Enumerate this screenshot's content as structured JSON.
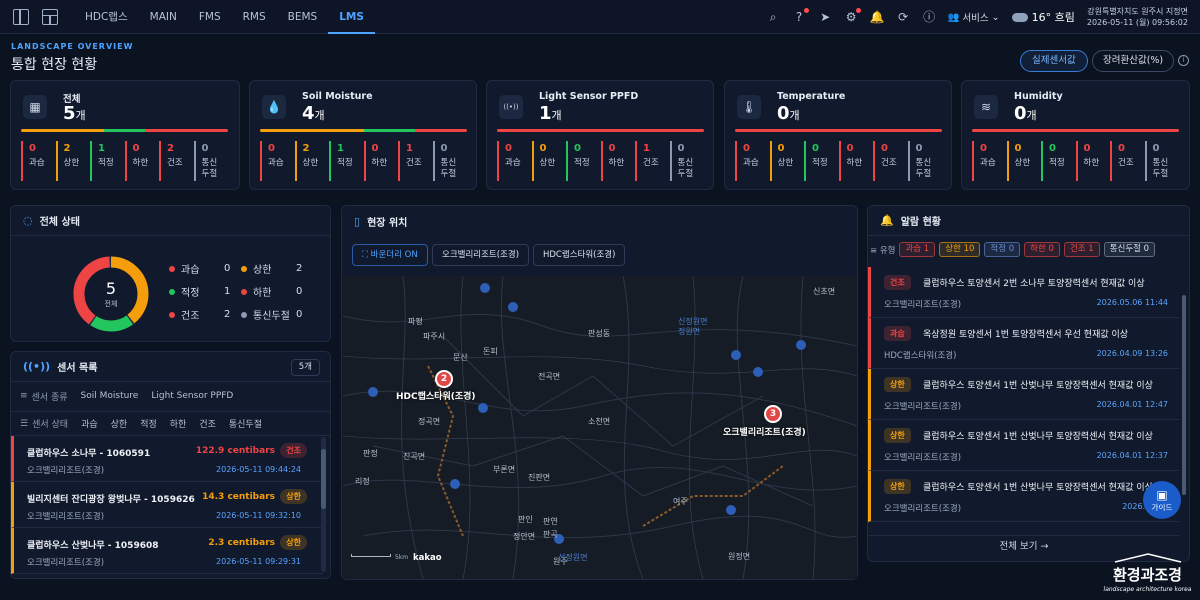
{
  "nav": {
    "items": [
      "HDC랩스",
      "MAIN",
      "FMS",
      "RMS",
      "BEMS",
      "LMS"
    ],
    "active": "LMS"
  },
  "header": {
    "service": "서비스",
    "temp": "16° 흐림",
    "location": "강원특별자치도 원주시 지정면",
    "datetime": "2026-05-11 (월) 09:56:02"
  },
  "page": {
    "overline": "LANDSCAPE OVERVIEW",
    "title": "통합 현장 현황",
    "btn_real": "실제센서값",
    "btn_conv": "장려환산값(%)"
  },
  "stat_labels": [
    "과습",
    "상한",
    "적정",
    "하한",
    "건조",
    "통신\n두절"
  ],
  "stat_colors": [
    "#ef4444",
    "#f59e0b",
    "#22c55e",
    "#ef4444",
    "#ef4444",
    "#8b9ab2"
  ],
  "cards": [
    {
      "name": "전체",
      "count": "5",
      "unit": "개",
      "values": [
        "0",
        "2",
        "1",
        "0",
        "2",
        "0"
      ],
      "icon": "grid-icon"
    },
    {
      "name": "Soil Moisture",
      "count": "4",
      "unit": "개",
      "values": [
        "0",
        "2",
        "1",
        "0",
        "1",
        "0"
      ],
      "icon": "drop-icon"
    },
    {
      "name": "Light Sensor PPFD",
      "count": "1",
      "unit": "개",
      "values": [
        "0",
        "0",
        "0",
        "0",
        "1",
        "0"
      ],
      "icon": "signal-icon"
    },
    {
      "name": "Temperature",
      "count": "0",
      "unit": "개",
      "values": [
        "0",
        "0",
        "0",
        "0",
        "0",
        "0"
      ],
      "icon": "thermometer-icon"
    },
    {
      "name": "Humidity",
      "count": "0",
      "unit": "개",
      "values": [
        "0",
        "0",
        "0",
        "0",
        "0",
        "0"
      ],
      "icon": "fan-icon"
    }
  ],
  "status": {
    "title": "전체 상태",
    "total": "5",
    "total_label": "전체",
    "legend": [
      {
        "label": "과습",
        "value": "0",
        "color": "#ef4444"
      },
      {
        "label": "상한",
        "value": "2",
        "color": "#f59e0b"
      },
      {
        "label": "적정",
        "value": "1",
        "color": "#22c55e"
      },
      {
        "label": "하한",
        "value": "0",
        "color": "#ef4444"
      },
      {
        "label": "건조",
        "value": "2",
        "color": "#ef4444"
      },
      {
        "label": "통신두절",
        "value": "0",
        "color": "#8b9ab2"
      }
    ]
  },
  "sensors": {
    "title": "센서 목록",
    "count": "5개",
    "type_label": "센서 종류",
    "types": [
      "Soil Moisture",
      "Light Sensor PPFD"
    ],
    "state_label": "센서 상태",
    "states": [
      "과습",
      "상한",
      "적정",
      "하한",
      "건조",
      "통신두절"
    ],
    "rows": [
      {
        "name": "클럽하우스 소나무 - 1060591",
        "site": "오크밸리리조트(조경)",
        "value": "122.9 centibars",
        "badge": "건조",
        "date": "2026-05-11 09:44:24",
        "color": "#ef4444"
      },
      {
        "name": "빌리지센터 잔디광장 왕벚나무 - 1059626",
        "site": "오크밸리리조트(조경)",
        "value": "14.3 centibars",
        "badge": "상한",
        "date": "2026-05-11 09:32:10",
        "color": "#f59e0b"
      },
      {
        "name": "클럽하우스 산벚나무 - 1059608",
        "site": "오크밸리리조트(조경)",
        "value": "2.3 centibars",
        "badge": "상한",
        "date": "2026-05-11 09:29:31",
        "color": "#f59e0b"
      }
    ]
  },
  "map": {
    "title": "현장 위치",
    "boundary": "바운더리 ON",
    "tabs": [
      "오크밸리리조트(조경)",
      "HDC랩스타워(조경)"
    ],
    "markers": [
      {
        "num": "2",
        "label": "HDC랩스타워(조경)"
      },
      {
        "num": "3",
        "label": "오크밸리리조트(조경)"
      }
    ],
    "places": [
      "신초면",
      "판성동",
      "신정원면",
      "정원면",
      "파평",
      "문산",
      "돈피",
      "파주시",
      "전곡면",
      "정곡면",
      "진곡면",
      "소천면",
      "여주",
      "부론면",
      "판인",
      "판연",
      "판곡",
      "진판면",
      "정안면",
      "리정",
      "원주",
      "판정",
      "선정원면",
      "원정면"
    ],
    "kakao": "kakao",
    "scale": "5km"
  },
  "alerts": {
    "title": "알람 현황",
    "type_label": "유형",
    "tags": [
      {
        "label": "과습 1",
        "color": "#ef4444"
      },
      {
        "label": "상한 10",
        "color": "#f59e0b"
      },
      {
        "label": "적정 0",
        "color": "#6b8bd1"
      },
      {
        "label": "하한 0",
        "color": "#ef4444"
      },
      {
        "label": "건조 1",
        "color": "#ef4444"
      },
      {
        "label": "통신두절 0",
        "color": "#8b9ab2"
      }
    ],
    "rows": [
      {
        "badge": "건조",
        "text": "클럽하우스 토양센서 2번 소나무 토양장력센서 현재값 이상",
        "site": "오크밸리리조트(조경)",
        "date": "2026.05.06 11:44",
        "color": "#ef4444"
      },
      {
        "badge": "과습",
        "text": "옥상정원 토양센서 1번 토양장력센서 우선 현재값 이상",
        "site": "HDC랩스타워(조경)",
        "date": "2026.04.09 13:26",
        "color": "#ef4444"
      },
      {
        "badge": "상한",
        "text": "클럽하우스 토양센서 1번 산벚나무 토양장력센서 현재값 이상",
        "site": "오크밸리리조트(조경)",
        "date": "2026.04.01 12:47",
        "color": "#f59e0b"
      },
      {
        "badge": "상한",
        "text": "클럽하우스 토양센서 1번 산벚나무 토양장력센서 현재값 이상",
        "site": "오크밸리리조트(조경)",
        "date": "2026.04.01 12:37",
        "color": "#f59e0b"
      },
      {
        "badge": "상한",
        "text": "클럽하우스 토양센서 1번 산벚나무 토양장력센서 현재값 이상",
        "site": "오크밸리리조트(조경)",
        "date": "2026.04.01",
        "color": "#f59e0b"
      }
    ],
    "view_all": "전체 보기 →"
  },
  "guide": "가이드",
  "logo": {
    "name": "환경과조경",
    "tag": "landscape architecture korea"
  }
}
